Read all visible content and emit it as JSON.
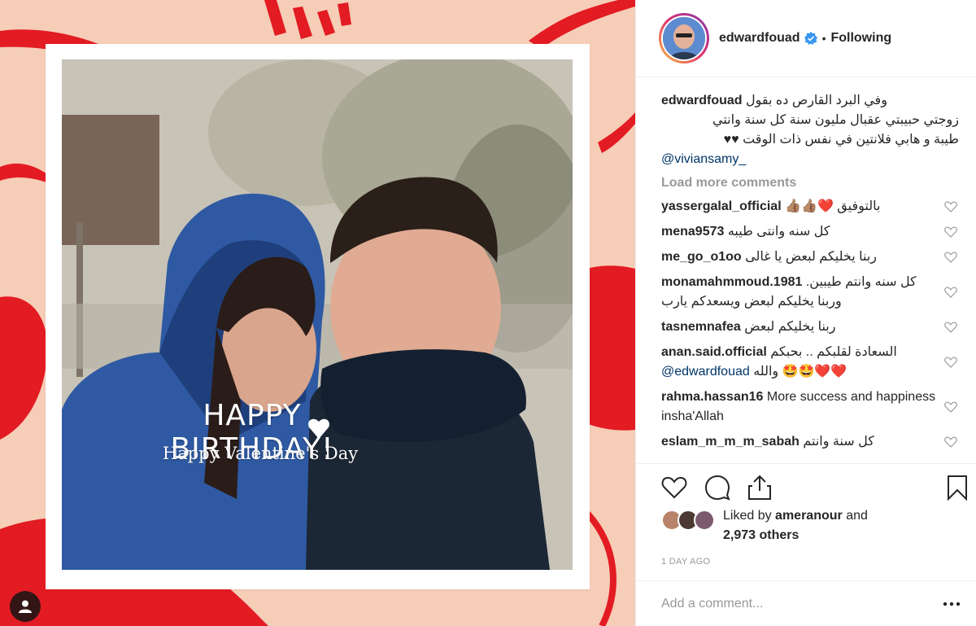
{
  "post": {
    "image_text": {
      "headline": "HAPPY BIRTHDAY!",
      "subline": "Happy Valentine's Day"
    }
  },
  "header": {
    "username": "edwardfouad",
    "separator": "•",
    "follow_state": "Following",
    "verified": true
  },
  "caption": {
    "username": "edwardfouad",
    "line1": "وفي البرد القارص ده بقول",
    "line2": "زوجتي حبيبتي عقبال مليون سنة كل سنة وانتي",
    "line3": "طيبة و هابي فلانتين في نفس ذات الوقت ♥♥",
    "mention": "@viviansamy_"
  },
  "load_more": "Load more comments",
  "comments": [
    {
      "user": "yassergalal_official",
      "text": "بالتوفيق ❤️👍🏽👍🏽"
    },
    {
      "user": "mena9573",
      "text": "كل سنه وانتى طيبه"
    },
    {
      "user": "me_go_o1oo",
      "text": "ربنا يخليكم لبعض يا غالى"
    },
    {
      "user": "monamahmmoud.1981",
      "text": "كل سنه وانتم طيبين. وربنا يخليكم لبعض ويسعدكم يارب"
    },
    {
      "user": "tasnemnafea",
      "text": "ربنا يخليكم لبعض"
    },
    {
      "user": "anan.said.official",
      "text": "السعادة لقلبكم .. بحبكم",
      "mention": "@edwardfouad",
      "tail": "❤️❤️🤩🤩 والله"
    },
    {
      "user": "rahma.hassan16",
      "text": "More success and happiness insha'Allah"
    },
    {
      "user": "eslam_m_m_m_sabah",
      "text": "كل سنة وانتم"
    }
  ],
  "likes": {
    "prefix": "Liked by",
    "user": "ameranour",
    "and": "and",
    "others": "2,973 others"
  },
  "timestamp": "1 DAY AGO",
  "add_comment": {
    "placeholder": "Add a comment..."
  },
  "icons": [
    "heart-icon",
    "comment-icon",
    "share-icon",
    "bookmark-icon",
    "more-options-icon",
    "tag-user-icon",
    "verified-badge-icon"
  ],
  "colors": {
    "accent_red": "#e31b23",
    "background_peach": "#f6cdb6",
    "mention_blue": "#003569",
    "muted_gray": "#999999",
    "verified_blue": "#3897f0"
  }
}
